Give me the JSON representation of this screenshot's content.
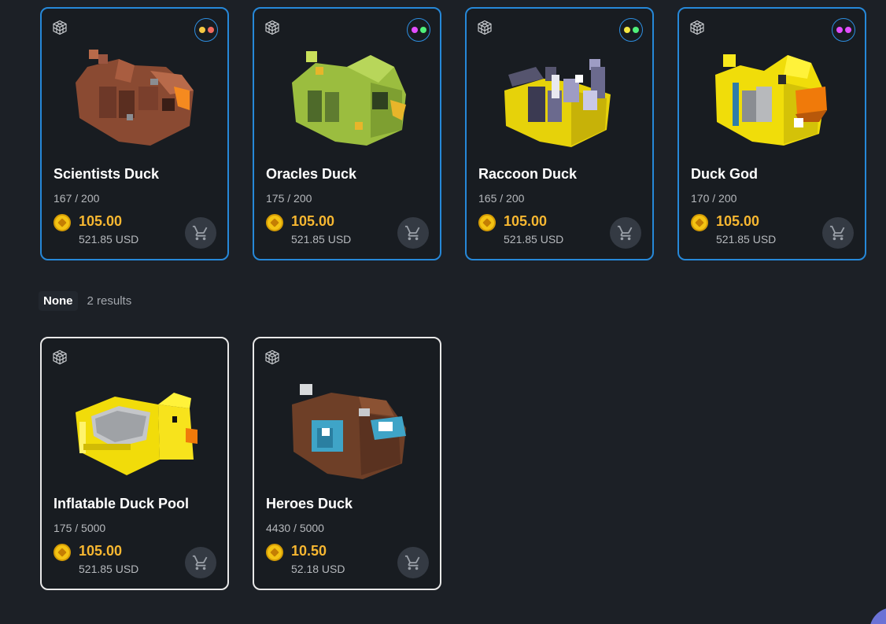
{
  "cards_top": [
    {
      "name": "Scientists Duck",
      "count": "167 / 200",
      "price": "105.00",
      "usd": "521.85 USD",
      "dots": [
        "#f5c842",
        "#f26b5e"
      ]
    },
    {
      "name": "Oracles Duck",
      "count": "175 / 200",
      "price": "105.00",
      "usd": "521.85 USD",
      "dots": [
        "#e24dff",
        "#4ff07a"
      ]
    },
    {
      "name": "Raccoon Duck",
      "count": "165 / 200",
      "price": "105.00",
      "usd": "521.85 USD",
      "dots": [
        "#f5e742",
        "#4ff07a"
      ]
    },
    {
      "name": "Duck God",
      "count": "170 / 200",
      "price": "105.00",
      "usd": "521.85 USD",
      "dots": [
        "#e24dff",
        "#e24dff"
      ]
    }
  ],
  "group": {
    "label": "None",
    "results": "2 results"
  },
  "cards_bottom": [
    {
      "name": "Inflatable Duck Pool",
      "count": "175 / 5000",
      "price": "105.00",
      "usd": "521.85 USD"
    },
    {
      "name": "Heroes Duck",
      "count": "4430 / 5000",
      "price": "10.50",
      "usd": "52.18 USD"
    }
  ],
  "colors": {
    "card_border_top": "#2688d8",
    "card_border_bottom": "#e8e8e8",
    "price": "#f7b731",
    "background": "#1c2026"
  },
  "icons": {
    "model": "cube-wireframe-icon",
    "cart": "shopping-cart-icon",
    "coin": "coin-icon"
  }
}
